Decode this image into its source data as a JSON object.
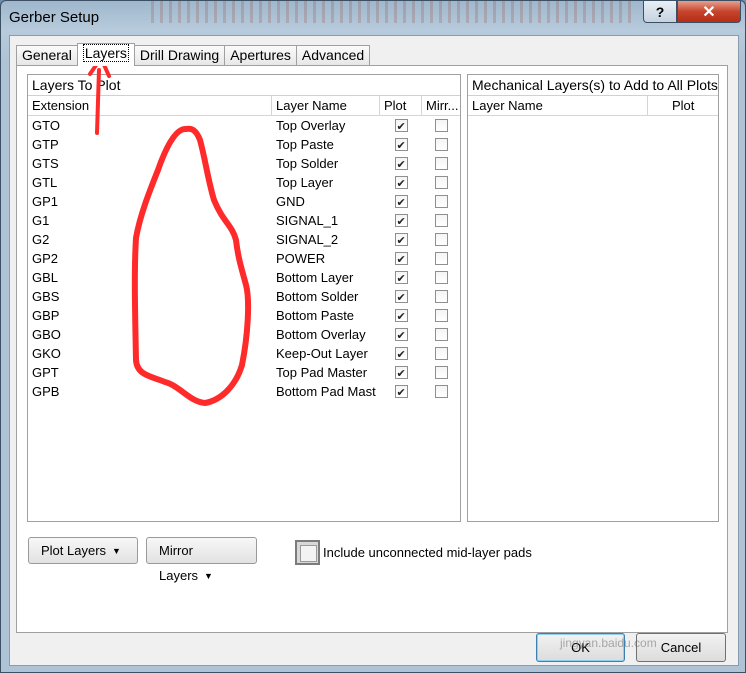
{
  "window": {
    "title": "Gerber Setup",
    "help_label": "?",
    "close_label": "✕"
  },
  "tabs": [
    {
      "label": "General"
    },
    {
      "label": "Layers",
      "active": true
    },
    {
      "label": "Drill Drawing"
    },
    {
      "label": "Apertures"
    },
    {
      "label": "Advanced"
    }
  ],
  "layers_panel": {
    "title": "Layers To Plot",
    "columns": {
      "extension": "Extension",
      "layer_name": "Layer Name",
      "plot": "Plot",
      "mirror": "Mirr..."
    },
    "rows": [
      {
        "ext": "GTO",
        "name": "Top Overlay",
        "plot": true,
        "mirror": false
      },
      {
        "ext": "GTP",
        "name": "Top Paste",
        "plot": true,
        "mirror": false
      },
      {
        "ext": "GTS",
        "name": "Top Solder",
        "plot": true,
        "mirror": false
      },
      {
        "ext": "GTL",
        "name": "Top Layer",
        "plot": true,
        "mirror": false
      },
      {
        "ext": "GP1",
        "name": "GND",
        "plot": true,
        "mirror": false
      },
      {
        "ext": "G1",
        "name": "SIGNAL_1",
        "plot": true,
        "mirror": false
      },
      {
        "ext": "G2",
        "name": "SIGNAL_2",
        "plot": true,
        "mirror": false
      },
      {
        "ext": "GP2",
        "name": "POWER",
        "plot": true,
        "mirror": false
      },
      {
        "ext": "GBL",
        "name": "Bottom Layer",
        "plot": true,
        "mirror": false
      },
      {
        "ext": "GBS",
        "name": "Bottom Solder",
        "plot": true,
        "mirror": false
      },
      {
        "ext": "GBP",
        "name": "Bottom Paste",
        "plot": true,
        "mirror": false
      },
      {
        "ext": "GBO",
        "name": "Bottom Overlay",
        "plot": true,
        "mirror": false
      },
      {
        "ext": "GKO",
        "name": "Keep-Out Layer",
        "plot": true,
        "mirror": false
      },
      {
        "ext": "GPT",
        "name": "Top Pad Master",
        "plot": true,
        "mirror": false
      },
      {
        "ext": "GPB",
        "name": "Bottom Pad Mast",
        "plot": true,
        "mirror": false
      }
    ]
  },
  "mech_panel": {
    "title": "Mechanical Layers(s) to Add to All Plots",
    "columns": {
      "layer_name": "Layer Name",
      "plot": "Plot"
    }
  },
  "controls": {
    "plot_layers": "Plot Layers",
    "mirror_layers": "Mirror Layers",
    "include_unconnected": "Include unconnected mid-layer pads",
    "include_unconnected_checked": false,
    "ok": "OK",
    "cancel": "Cancel"
  },
  "watermark": {
    "logo": "Bai百 经验",
    "sub": "jingyan.baidu.com"
  },
  "colors": {
    "annotation": "#ff2a2a",
    "close_button": "#c7442c"
  }
}
